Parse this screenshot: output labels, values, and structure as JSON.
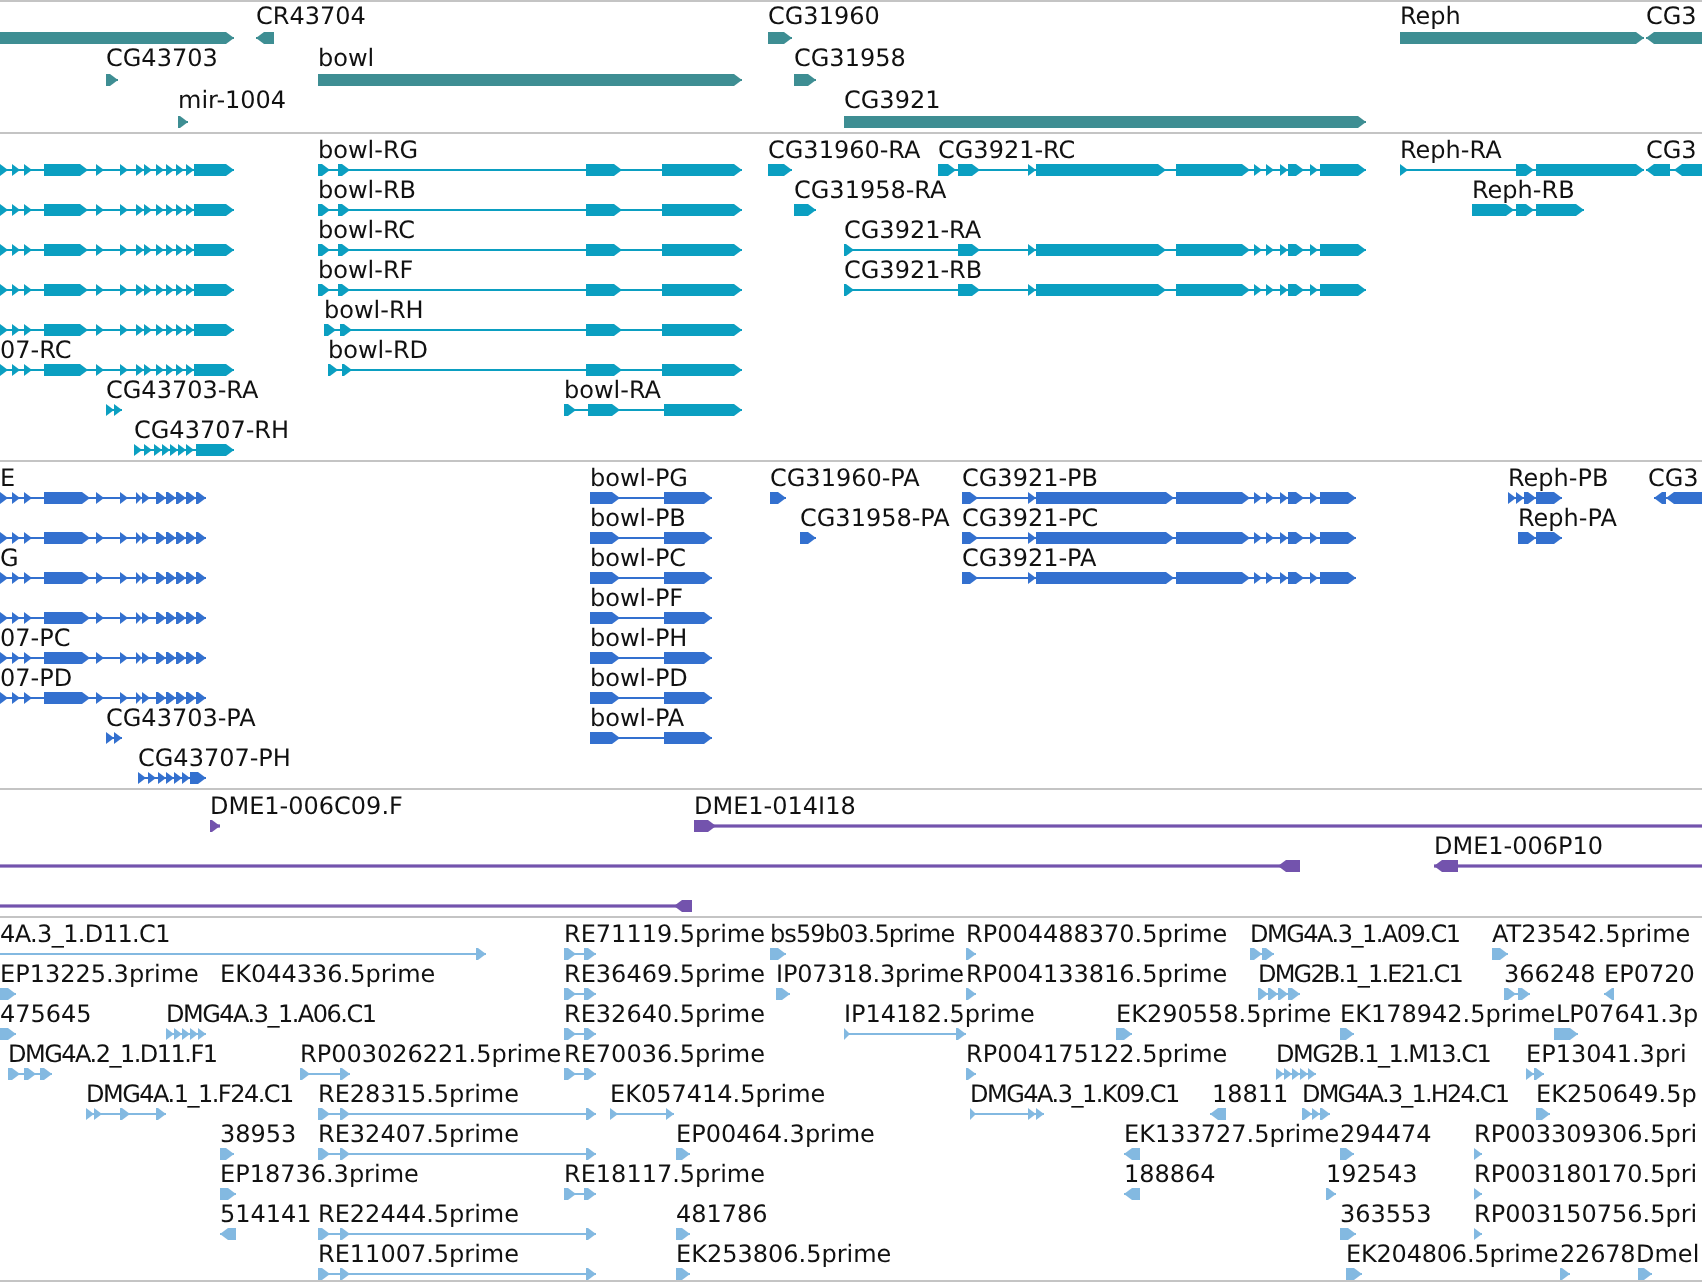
{
  "tracks": [
    {
      "features": [
        {
          "reverse": false
        },
        {
          "label": "CR43704",
          "reverse": true
        },
        {
          "label": "CG31960",
          "reverse": false
        },
        {
          "label": "Reph",
          "reverse": false
        },
        {
          "label": "CG3",
          "reverse": true
        },
        {
          "label": "CG43703",
          "reverse": false
        },
        {
          "label": "bowl",
          "reverse": false
        },
        {
          "label": "CG31958",
          "reverse": false
        },
        {
          "label": "mir-1004",
          "reverse": false
        },
        {
          "label": "CG3921",
          "reverse": false
        }
      ]
    },
    {
      "features": [
        {
          "reverse": false
        },
        {
          "label": "bowl-RG",
          "reverse": false
        },
        {
          "label": "CG31960-RA",
          "reverse": false
        },
        {
          "label": "CG3921-RC",
          "reverse": false
        },
        {
          "label": "Reph-RA",
          "reverse": false
        },
        {
          "label": "CG3",
          "reverse": true
        },
        {
          "reverse": false
        },
        {
          "label": "bowl-RB",
          "reverse": false
        },
        {
          "label": "CG31958-RA",
          "reverse": false
        },
        {
          "label": "Reph-RB",
          "reverse": false
        },
        {
          "reverse": false
        },
        {
          "label": "bowl-RC",
          "reverse": false
        },
        {
          "label": "CG3921-RA",
          "reverse": false
        },
        {
          "reverse": false
        },
        {
          "label": "bowl-RF",
          "reverse": false
        },
        {
          "label": "CG3921-RB",
          "reverse": false
        },
        {
          "reverse": false
        },
        {
          "label": "bowl-RH",
          "reverse": false
        },
        {
          "label": "07-RC",
          "reverse": false
        },
        {
          "label": "bowl-RD",
          "reverse": false
        },
        {
          "label": "CG43703-RA",
          "reverse": false
        },
        {
          "label": "bowl-RA",
          "reverse": false
        },
        {
          "label": "CG43707-RH",
          "reverse": false
        }
      ]
    },
    {
      "features": [
        {
          "label": "E",
          "reverse": false
        },
        {
          "label": "bowl-PG",
          "reverse": false
        },
        {
          "label": "CG31960-PA",
          "reverse": false
        },
        {
          "label": "CG3921-PB",
          "reverse": false
        },
        {
          "label": "Reph-PB",
          "reverse": false
        },
        {
          "label": "CG3",
          "reverse": true
        },
        {
          "reverse": false
        },
        {
          "label": "bowl-PB",
          "reverse": false
        },
        {
          "label": "CG31958-PA",
          "reverse": false
        },
        {
          "label": "CG3921-PC",
          "reverse": false
        },
        {
          "label": "Reph-PA",
          "reverse": false
        },
        {
          "label": "G",
          "reverse": false
        },
        {
          "label": "bowl-PC",
          "reverse": false
        },
        {
          "label": "CG3921-PA",
          "reverse": false
        },
        {
          "reverse": false
        },
        {
          "label": "bowl-PF",
          "reverse": false
        },
        {
          "label": "07-PC",
          "reverse": false
        },
        {
          "label": "bowl-PH",
          "reverse": false
        },
        {
          "label": "07-PD",
          "reverse": false
        },
        {
          "label": "bowl-PD",
          "reverse": false
        },
        {
          "label": "CG43703-PA",
          "reverse": false
        },
        {
          "label": "bowl-PA",
          "reverse": false
        },
        {
          "label": "CG43707-PH",
          "reverse": false
        }
      ]
    },
    {
      "features": [
        {
          "label": "DME1-006C09.F",
          "reverse": false
        },
        {
          "label": "DME1-014I18",
          "reverse": false
        },
        {
          "reverse": true
        },
        {
          "label": "DME1-006P10",
          "reverse": true
        },
        {
          "reverse": true
        }
      ]
    },
    {
      "features": [
        {
          "label": "4A.3_1.D11.C1",
          "reverse": false
        },
        {
          "label": "RE71119.5prime",
          "reverse": false
        },
        {
          "label": "bs59b03.5prime",
          "reverse": false
        },
        {
          "label": "RP004488370.5prime",
          "reverse": false
        },
        {
          "label": "DMG4A.3_1.A09.C1",
          "reverse": false
        },
        {
          "label": "AT23542.5prime",
          "reverse": false
        },
        {
          "label": "EP13225.3prime",
          "reverse": false
        },
        {
          "label": "EK044336.5prime"
        },
        {
          "label": "RE36469.5prime",
          "reverse": false
        },
        {
          "label": "IP07318.3prime",
          "reverse": false
        },
        {
          "label": "RP004133816.5prime",
          "reverse": false
        },
        {
          "label": "DMG2B.1_1.E21.C1",
          "reverse": false
        },
        {
          "label": "366248",
          "reverse": false
        },
        {
          "label": "EP0720",
          "reverse": true
        },
        {
          "label": "475645",
          "reverse": false
        },
        {
          "label": "DMG4A.3_1.A06.C1",
          "reverse": false
        },
        {
          "label": "RE32640.5prime",
          "reverse": false
        },
        {
          "label": "IP14182.5prime",
          "reverse": false
        },
        {
          "label": "EK290558.5prime",
          "reverse": false
        },
        {
          "label": "EK178942.5prime",
          "reverse": false
        },
        {
          "label": "LP07641.3p",
          "reverse": false
        },
        {
          "label": "DMG4A.2_1.D11.F1",
          "reverse": false
        },
        {
          "label": "RP003026221.5prime",
          "reverse": false
        },
        {
          "label": "RE70036.5prime",
          "reverse": false
        },
        {
          "label": "RP004175122.5prime",
          "reverse": false
        },
        {
          "label": "DMG2B.1_1.M13.C1",
          "reverse": false
        },
        {
          "label": "EP13041.3pri",
          "reverse": false
        },
        {
          "label": "DMG4A.1_1.F24.C1",
          "reverse": false
        },
        {
          "label": "RE28315.5prime",
          "reverse": false
        },
        {
          "label": "EK057414.5prime",
          "reverse": false
        },
        {
          "label": "DMG4A.3_1.K09.C1",
          "reverse": false
        },
        {
          "label": "18811",
          "reverse": true
        },
        {
          "label": "DMG4A.3_1.H24.C1",
          "reverse": false
        },
        {
          "label": "EK250649.5p",
          "reverse": false
        },
        {
          "label": "38953",
          "reverse": false
        },
        {
          "label": "RE32407.5prime",
          "reverse": false
        },
        {
          "label": "EP00464.3prime",
          "reverse": false
        },
        {
          "label": "EK133727.5prime",
          "reverse": true
        },
        {
          "label": "294474",
          "reverse": false
        },
        {
          "label": "RP003309306.5pri",
          "reverse": false
        },
        {
          "label": "EP18736.3prime",
          "reverse": false
        },
        {
          "label": "RE18117.5prime",
          "reverse": false
        },
        {
          "label": "188864",
          "reverse": true
        },
        {
          "label": "192543",
          "reverse": false
        },
        {
          "label": "RP003180170.5pri",
          "reverse": false
        },
        {
          "label": "514141",
          "reverse": true
        },
        {
          "label": "RE22444.5prime",
          "reverse": false
        },
        {
          "label": "481786",
          "reverse": false
        },
        {
          "label": "363553",
          "reverse": false
        },
        {
          "label": "RP003150756.5pri",
          "reverse": false
        },
        {
          "label": "RE11007.5prime",
          "reverse": false
        },
        {
          "label": "EK253806.5prime",
          "reverse": false
        },
        {
          "label": "EK204806.5prime",
          "reverse": false
        },
        {
          "label": "22678",
          "reverse": false
        },
        {
          "label": "Dmel",
          "reverse": false
        }
      ]
    }
  ]
}
